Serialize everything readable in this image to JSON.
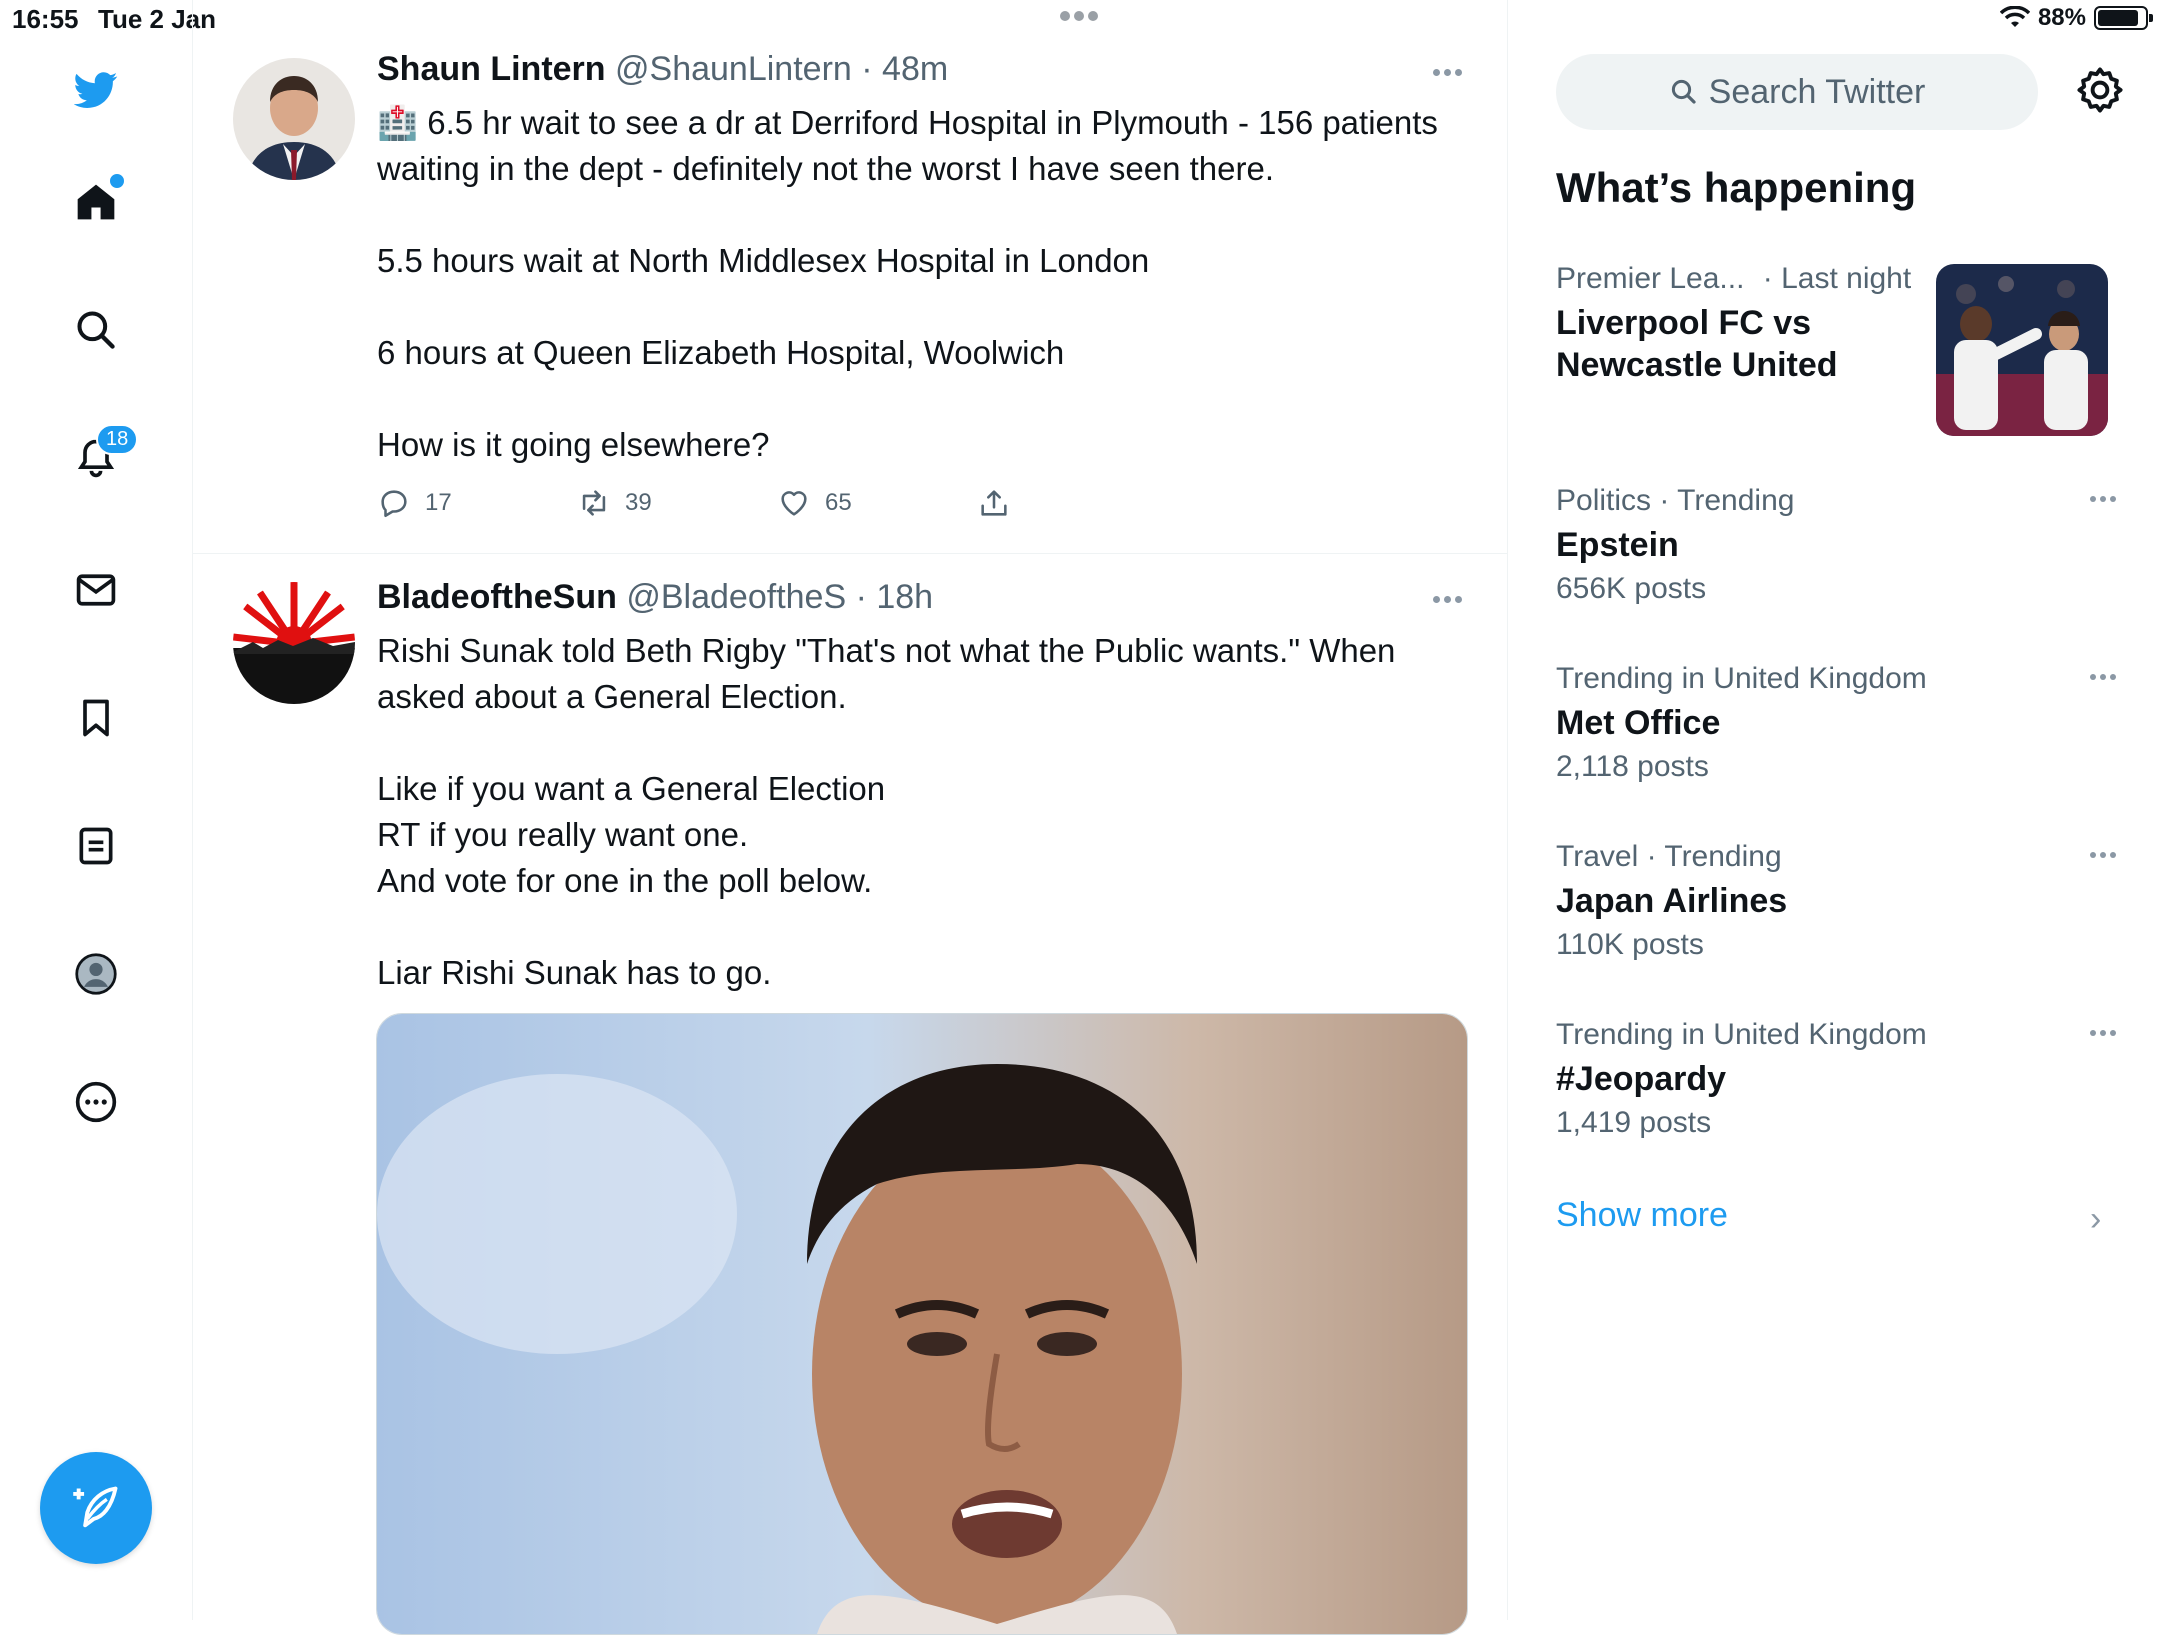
{
  "status_bar": {
    "time": "16:55",
    "date": "Tue 2 Jan",
    "battery": "88%",
    "battery_level": 0.88
  },
  "nav": {
    "notifications_count": "18",
    "icons": [
      "twitter-logo-icon",
      "home-icon",
      "search-icon",
      "bell-icon",
      "mail-icon",
      "bookmark-icon",
      "lists-icon",
      "profile-icon",
      "more-icon",
      "compose-icon"
    ]
  },
  "tweets": [
    {
      "name": "Shaun Lintern",
      "handle": "@ShaunLintern",
      "time": "· 48m",
      "lines": [
        "🏥 6.5 hr wait to see a dr at Derriford Hospital in Plymouth  - 156 patients waiting in the dept - definitely not the worst I have seen there.",
        "5.5 hours wait at North Middlesex Hospital in London",
        "6 hours at Queen Elizabeth Hospital, Woolwich",
        "How is it going elsewhere?"
      ],
      "replies": "17",
      "retweets": "39",
      "likes": "65"
    },
    {
      "name": "BladeoftheSun",
      "handle": "@BladeoftheS",
      "time": "· 18h",
      "lines": [
        "Rishi Sunak told Beth Rigby \"That's not what the Public wants.\" When asked about a General Election.",
        "Like if you want a General Election",
        "RT if you really want one.",
        "And vote for one in the poll below.",
        "Liar Rishi Sunak has to go."
      ]
    }
  ],
  "sidebar": {
    "search_placeholder": "Search Twitter",
    "title": "What’s happening",
    "trends": [
      {
        "category": "Premier Lea...",
        "meta": "· Last night",
        "title": "Liverpool FC vs Newcastle United",
        "count": ""
      },
      {
        "category": "Politics · Trending",
        "meta": "",
        "title": "Epstein",
        "count": "656K posts"
      },
      {
        "category": "Trending in United Kingdom",
        "meta": "",
        "title": "Met Office",
        "count": "2,118 posts"
      },
      {
        "category": "Travel · Trending",
        "meta": "",
        "title": "Japan Airlines",
        "count": "110K posts"
      },
      {
        "category": "Trending in United Kingdom",
        "meta": "",
        "title": "#Jeopardy",
        "count": "1,419 posts"
      }
    ],
    "show_more": "Show more"
  },
  "colors": {
    "accent": "#1d9bf0",
    "text": "#0f1419",
    "muted": "#536471"
  }
}
